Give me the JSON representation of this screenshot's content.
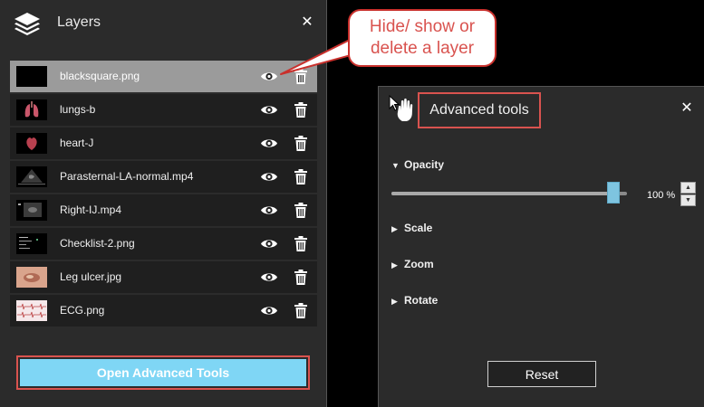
{
  "layers_panel": {
    "title": "Layers",
    "logo_icon": "layers-stack-icon",
    "close_icon": "close-icon",
    "layers": [
      {
        "name": "blacksquare.png",
        "selected": true,
        "thumb": "black"
      },
      {
        "name": "lungs-b",
        "selected": false,
        "thumb": "lungs"
      },
      {
        "name": "heart-J",
        "selected": false,
        "thumb": "heart"
      },
      {
        "name": "Parasternal-LA-normal.mp4",
        "selected": false,
        "thumb": "ultrasound"
      },
      {
        "name": "Right-IJ.mp4",
        "selected": false,
        "thumb": "ultrasound2"
      },
      {
        "name": "Checklist-2.png",
        "selected": false,
        "thumb": "checklist"
      },
      {
        "name": "Leg ulcer.jpg",
        "selected": false,
        "thumb": "skin"
      },
      {
        "name": "ECG.png",
        "selected": false,
        "thumb": "ecg"
      }
    ],
    "open_advanced_label": "Open Advanced Tools"
  },
  "callout": {
    "line1": "Hide/ show or",
    "line2": "delete a layer"
  },
  "advanced_panel": {
    "title": "Advanced tools",
    "cursor_icon": "hand-pointer-icon",
    "close_icon": "close-icon",
    "opacity": {
      "label": "Opacity",
      "expanded": true,
      "value": 100,
      "value_text": "100 %"
    },
    "sections": [
      {
        "label": "Scale",
        "expanded": false
      },
      {
        "label": "Zoom",
        "expanded": false
      },
      {
        "label": "Rotate",
        "expanded": false
      }
    ],
    "reset_label": "Reset"
  },
  "colors": {
    "panel_bg": "#2b2b2b",
    "row_bg": "#1f1f1f",
    "selected_row_bg": "#9b9b9b",
    "accent_button": "#7fd6f5",
    "highlight_border": "#d9534f",
    "slider_thumb": "#7ec4e0"
  }
}
